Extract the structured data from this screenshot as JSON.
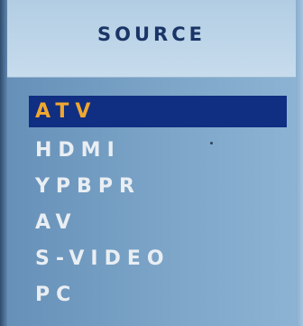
{
  "osd": {
    "title": "SOURCE",
    "items": [
      {
        "label": "ATV",
        "selected": true
      },
      {
        "label": "HDMI",
        "selected": false
      },
      {
        "label": "YPBPR",
        "selected": false
      },
      {
        "label": "AV",
        "selected": false
      },
      {
        "label": "S-VIDEO",
        "selected": false
      },
      {
        "label": "PC",
        "selected": false
      }
    ]
  },
  "colors": {
    "header_text": "#1a3566",
    "selected_bg": "#102e82",
    "selected_text": "#f0a72e",
    "item_text": "#e9eef3"
  }
}
